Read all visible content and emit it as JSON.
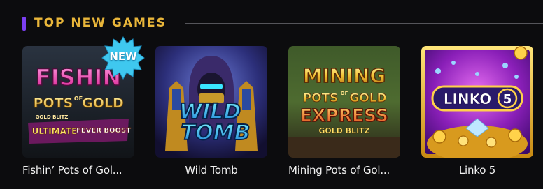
{
  "section": {
    "title": "TOP NEW GAMES",
    "accent_color": "#7b3ff2",
    "title_color": "#e9b63a"
  },
  "badge": {
    "label": "NEW"
  },
  "games": [
    {
      "title": "Fishin’ Pots of Gol...",
      "art": {
        "line1": "FISHIN",
        "line2": "POTS",
        "of": "OF",
        "line3": "GOLD",
        "brand": "GOLD BLITZ",
        "tag1": "ULTIMATE",
        "tag2": "FEVER BOOST"
      }
    },
    {
      "title": "Wild Tomb",
      "art": {
        "line1": "WILD",
        "line2": "TOMB"
      }
    },
    {
      "title": "Mining Pots of Gol...",
      "art": {
        "line1": "MINING",
        "line2": "POTS",
        "of": "OF",
        "line3": "GOLD",
        "line4": "EXPRESS",
        "brand": "GOLD BLITZ"
      }
    },
    {
      "title": "Linko 5",
      "art": {
        "line1": "LINKO",
        "num": "5"
      }
    }
  ]
}
